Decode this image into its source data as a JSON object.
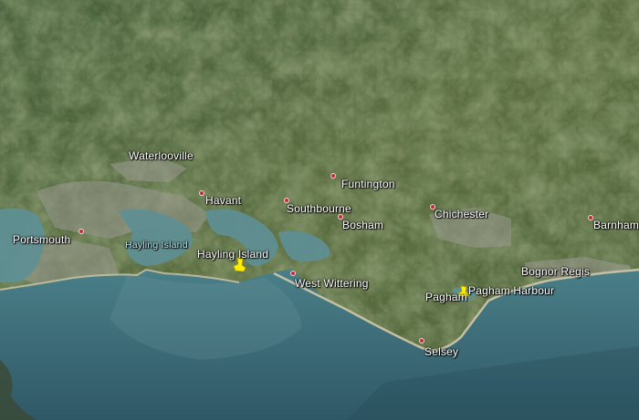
{
  "map": {
    "labels": {
      "waterlooville": "Waterlooville",
      "havant": "Havant",
      "funtington": "Funtington",
      "southbourne": "Southbourne",
      "bosham": "Bosham",
      "chichester": "Chichester",
      "barnham": "Barnham",
      "portsmouth": "Portsmouth",
      "hayling_island_water": "Hayling Island",
      "hayling_island": "Hayling Island",
      "west_wittering": "West Wittering",
      "bognor_regis": "Bognor Regis",
      "pagham": "Pagham",
      "pagham_harbour": "Pagham Harbour",
      "selsey": "Selsey"
    },
    "colors": {
      "sea": "#3b6b78",
      "land_dark": "#3f5c34",
      "land_light": "#7b8a5c",
      "urban": "#9a9a96",
      "marker": "#c22a3a",
      "pin": "#ffee00"
    },
    "icons": [
      "location-dot-icon",
      "yellow-pin-icon"
    ]
  }
}
